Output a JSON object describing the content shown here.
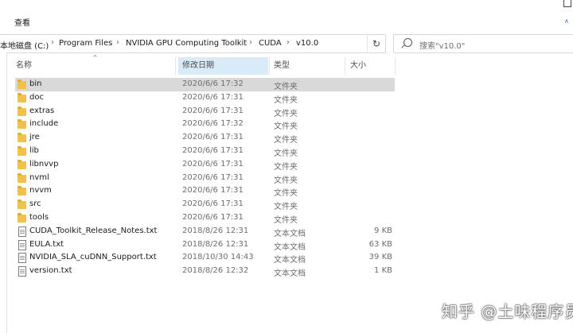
{
  "ribbon": {
    "view_tab": "查看"
  },
  "address": {
    "crumbs": [
      "本地磁盘 (C:)",
      "Program Files",
      "NVIDIA GPU Computing Toolkit",
      "CUDA",
      "v10.0"
    ],
    "separator": "›"
  },
  "search": {
    "placeholder": "搜索\"v10.0\""
  },
  "columns": {
    "name": "名称",
    "date": "修改日期",
    "type": "类型",
    "size": "大小"
  },
  "files": [
    {
      "name": "bin",
      "date": "2020/6/6 17:32",
      "type": "文件夹",
      "size": "",
      "icon": "folder-icon",
      "selected": true
    },
    {
      "name": "doc",
      "date": "2020/6/6 17:31",
      "type": "文件夹",
      "size": "",
      "icon": "folder-icon"
    },
    {
      "name": "extras",
      "date": "2020/6/6 17:31",
      "type": "文件夹",
      "size": "",
      "icon": "folder-icon"
    },
    {
      "name": "include",
      "date": "2020/6/6 17:32",
      "type": "文件夹",
      "size": "",
      "icon": "folder-icon"
    },
    {
      "name": "jre",
      "date": "2020/6/6 17:31",
      "type": "文件夹",
      "size": "",
      "icon": "folder-icon"
    },
    {
      "name": "lib",
      "date": "2020/6/6 17:31",
      "type": "文件夹",
      "size": "",
      "icon": "folder-icon"
    },
    {
      "name": "libnvvp",
      "date": "2020/6/6 17:31",
      "type": "文件夹",
      "size": "",
      "icon": "folder-icon"
    },
    {
      "name": "nvml",
      "date": "2020/6/6 17:31",
      "type": "文件夹",
      "size": "",
      "icon": "folder-icon"
    },
    {
      "name": "nvvm",
      "date": "2020/6/6 17:31",
      "type": "文件夹",
      "size": "",
      "icon": "folder-icon"
    },
    {
      "name": "src",
      "date": "2020/6/6 17:31",
      "type": "文件夹",
      "size": "",
      "icon": "folder-icon"
    },
    {
      "name": "tools",
      "date": "2020/6/6 17:31",
      "type": "文件夹",
      "size": "",
      "icon": "folder-icon"
    },
    {
      "name": "CUDA_Toolkit_Release_Notes.txt",
      "date": "2018/8/26 12:31",
      "type": "文本文档",
      "size": "9 KB",
      "icon": "text-file-icon"
    },
    {
      "name": "EULA.txt",
      "date": "2018/8/26 12:31",
      "type": "文本文档",
      "size": "63 KB",
      "icon": "text-file-icon"
    },
    {
      "name": "NVIDIA_SLA_cuDNN_Support.txt",
      "date": "2018/10/30 14:43",
      "type": "文本文档",
      "size": "39 KB",
      "icon": "text-file-icon"
    },
    {
      "name": "version.txt",
      "date": "2018/8/26 12:32",
      "type": "文本文档",
      "size": "1 KB",
      "icon": "text-file-icon"
    }
  ],
  "watermark": "知乎 @土味程序员",
  "colors": {
    "selected_row": "#d9d9d9",
    "sorted_header": "#d9ebf9",
    "folder": "#f0c24b"
  }
}
